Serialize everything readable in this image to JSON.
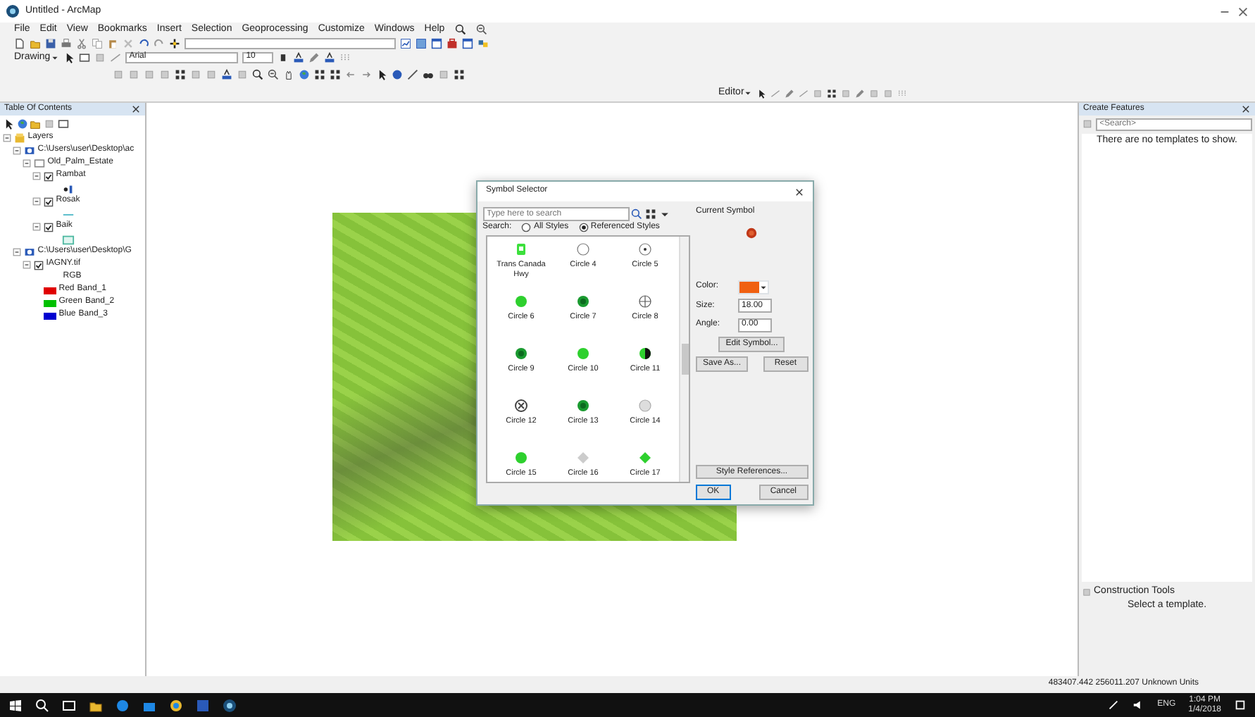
{
  "window": {
    "title": "Untitled - ArcMap"
  },
  "menu": [
    "File",
    "Edit",
    "View",
    "Bookmarks",
    "Insert",
    "Selection",
    "Geoprocessing",
    "Customize",
    "Windows",
    "Help"
  ],
  "drawing_toolbar": {
    "label": "Drawing",
    "font": "Arial",
    "size": "10"
  },
  "editor_toolbar": {
    "label": "Editor"
  },
  "toc": {
    "title": "Table Of Contents",
    "tree": [
      {
        "label": "Layers",
        "kind": "frame",
        "expanded": true,
        "children": [
          {
            "label": "C:\\Users\\user\\Desktop\\ac",
            "kind": "folder",
            "expanded": true,
            "children": [
              {
                "label": "Old_Palm_Estate",
                "kind": "group",
                "expanded": true,
                "children": [
                  {
                    "label": "Rambat",
                    "kind": "point",
                    "checked": true,
                    "expanded": true
                  },
                  {
                    "label": "Rosak",
                    "kind": "line",
                    "checked": true,
                    "expanded": true
                  },
                  {
                    "label": "Baik",
                    "kind": "polygon",
                    "checked": true,
                    "expanded": true
                  }
                ]
              }
            ]
          },
          {
            "label": "C:\\Users\\user\\Desktop\\G",
            "kind": "folder",
            "expanded": true,
            "children": [
              {
                "label": "IAGNY.tif",
                "kind": "raster",
                "checked": true,
                "expanded": true,
                "legend_title": "RGB",
                "bands": [
                  {
                    "name": "Red",
                    "band": "Band_1",
                    "color": "#e00000"
                  },
                  {
                    "name": "Green",
                    "band": "Band_2",
                    "color": "#00c000"
                  },
                  {
                    "name": "Blue",
                    "band": "Band_3",
                    "color": "#0000d0"
                  }
                ]
              }
            ]
          }
        ]
      }
    ]
  },
  "dialog": {
    "title": "Symbol Selector",
    "search_placeholder": "Type here to search",
    "search_label": "Search:",
    "scopes": [
      {
        "label": "All Styles",
        "selected": false
      },
      {
        "label": "Referenced Styles",
        "selected": true
      }
    ],
    "symbols": [
      {
        "label": "Trans Canada Hwy",
        "kind": "shield"
      },
      {
        "label": "Circle 4",
        "kind": "ring"
      },
      {
        "label": "Circle 5",
        "kind": "dot-ring"
      },
      {
        "label": "Circle 6",
        "kind": "bright"
      },
      {
        "label": "Circle 7",
        "kind": "dark"
      },
      {
        "label": "Circle 8",
        "kind": "crosshair"
      },
      {
        "label": "Circle 9",
        "kind": "dark"
      },
      {
        "label": "Circle 10",
        "kind": "bright"
      },
      {
        "label": "Circle 11",
        "kind": "half"
      },
      {
        "label": "Circle 12",
        "kind": "cross-ring"
      },
      {
        "label": "Circle 13",
        "kind": "dark"
      },
      {
        "label": "Circle 14",
        "kind": "grey"
      },
      {
        "label": "Circle 15",
        "kind": "bright"
      },
      {
        "label": "Circle 16",
        "kind": "grey-diamond"
      },
      {
        "label": "Circle 17",
        "kind": "diamond"
      }
    ],
    "current_label": "Current Symbol",
    "color_label": "Color:",
    "size_label": "Size:",
    "size": "18.00",
    "angle_label": "Angle:",
    "angle": "0.00",
    "buttons": {
      "edit": "Edit Symbol...",
      "save": "Save As...",
      "reset": "Reset",
      "refs": "Style References...",
      "ok": "OK",
      "cancel": "Cancel"
    }
  },
  "create_features": {
    "title": "Create Features",
    "search_placeholder": "<Search>",
    "empty": "There are no templates to show."
  },
  "construction_tools": {
    "title": "Construction Tools",
    "empty": "Select a template."
  },
  "status": {
    "coordinates": "483407.442  256011.207 Unknown Units"
  },
  "taskbar": {
    "language": "ENG",
    "time": "1:04 PM",
    "date": "1/4/2018"
  }
}
